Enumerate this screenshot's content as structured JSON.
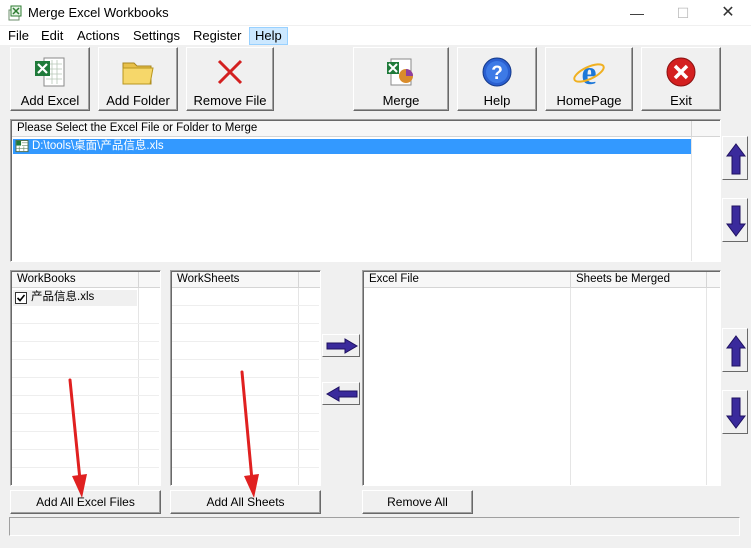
{
  "window": {
    "title": "Merge Excel Workbooks",
    "minimize_glyph": "—",
    "maximize_glyph": "☐",
    "close_glyph": "✕"
  },
  "menu": {
    "items": [
      {
        "label": "File"
      },
      {
        "label": "Edit"
      },
      {
        "label": "Actions"
      },
      {
        "label": "Settings"
      },
      {
        "label": "Register"
      },
      {
        "label": "Help"
      }
    ],
    "active": "Help"
  },
  "toolbar": {
    "add_excel": {
      "label": "Add Excel",
      "icon": "excel-file-icon"
    },
    "add_folder": {
      "label": "Add Folder",
      "icon": "folder-icon"
    },
    "remove_file": {
      "label": "Remove File",
      "icon": "red-x-icon"
    },
    "merge": {
      "label": "Merge",
      "icon": "merge-icon"
    },
    "help": {
      "label": "Help",
      "icon": "help-icon"
    },
    "homepage": {
      "label": "HomePage",
      "icon": "internet-explorer-icon"
    },
    "exit": {
      "label": "Exit",
      "icon": "exit-icon"
    }
  },
  "file_list": {
    "header": "Please Select the Excel File or Folder to Merge",
    "rows": [
      {
        "path": "D:\\tools\\桌面\\产品信息.xls",
        "selected": true
      }
    ]
  },
  "workbooks": {
    "header": "WorkBooks",
    "items": [
      {
        "name": "产品信息.xls",
        "checked": true
      }
    ]
  },
  "worksheets": {
    "header": "WorkSheets",
    "items": []
  },
  "merge_list": {
    "headers": [
      "Excel File",
      "Sheets be Merged"
    ],
    "rows": []
  },
  "buttons": {
    "add_all_excel": "Add All Excel Files",
    "add_all_sheets": "Add All Sheets",
    "remove_all": "Remove All"
  },
  "colors": {
    "selection": "#3399ff",
    "arrow_blue": "#3a2a9c",
    "annotation_red": "#e02020"
  }
}
